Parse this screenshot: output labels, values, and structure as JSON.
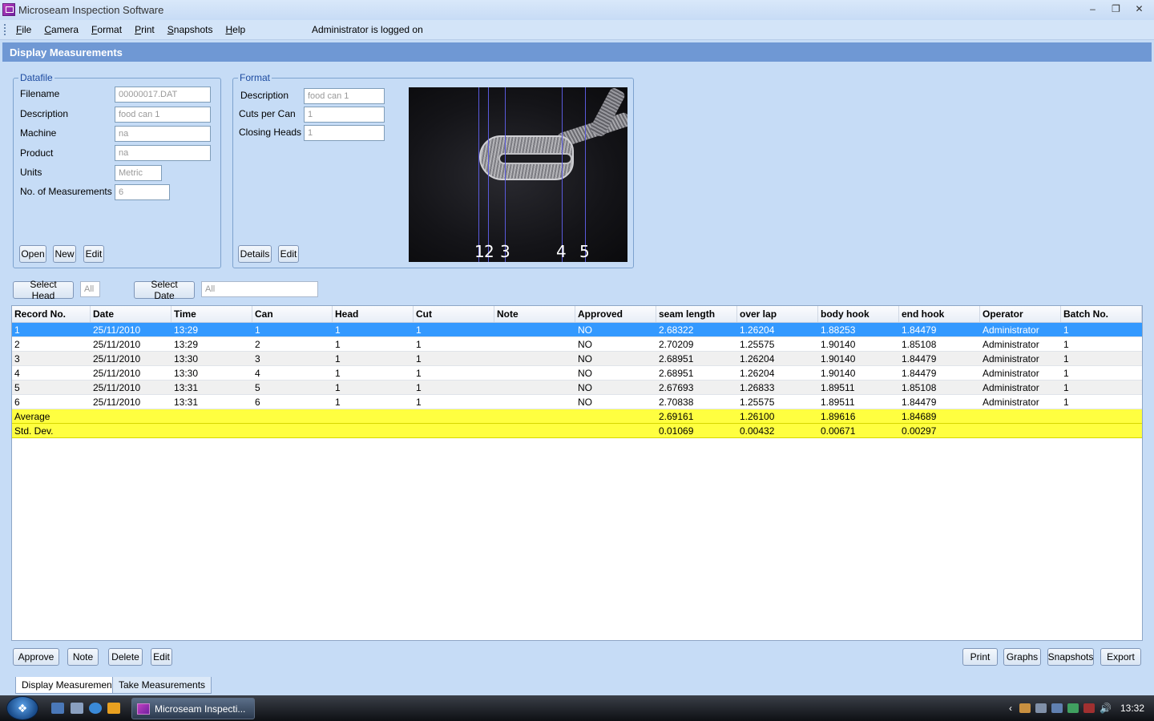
{
  "window": {
    "title": "Microseam Inspection Software"
  },
  "menu": {
    "items": [
      {
        "first": "F",
        "rest": "ile"
      },
      {
        "first": "C",
        "rest": "amera"
      },
      {
        "first": "F",
        "rest": "ormat"
      },
      {
        "first": "P",
        "rest": "rint"
      },
      {
        "first": "S",
        "rest": "napshots"
      },
      {
        "first": "H",
        "rest": "elp"
      }
    ],
    "status": "Administrator is logged on"
  },
  "header": {
    "title": "Display Measurements"
  },
  "datafile": {
    "legend": "Datafile",
    "filename_label": "Filename",
    "filename": "00000017.DAT",
    "description_label": "Description",
    "description": "food can 1",
    "machine_label": "Machine",
    "machine": "na",
    "product_label": "Product",
    "product": "na",
    "units_label": "Units",
    "units": "Metric",
    "count_label": "No. of Measurements",
    "count": "6",
    "open": "Open",
    "new": "New",
    "edit": "Edit"
  },
  "format": {
    "legend": "Format",
    "description_label": "Description",
    "description": "food can 1",
    "cuts_label": "Cuts per Can",
    "cuts": "1",
    "heads_label": "Closing Heads",
    "heads": "1",
    "details": "Details",
    "edit": "Edit",
    "line_labels": [
      "1",
      "2",
      "3",
      "4",
      "5"
    ]
  },
  "filters": {
    "select_head": "Select Head",
    "head_value": "All",
    "select_date": "Select Date",
    "date_value": "All"
  },
  "table": {
    "columns": [
      "Record No.",
      "Date",
      "Time",
      "Can",
      "Head",
      "Cut",
      "Note",
      "Approved",
      "seam length",
      "over lap",
      "body hook",
      "end hook",
      "Operator",
      "Batch No."
    ],
    "rows": [
      [
        "1",
        "25/11/2010",
        "13:29",
        "1",
        "1",
        "1",
        "",
        "NO",
        "2.68322",
        "1.26204",
        "1.88253",
        "1.84479",
        "Administrator",
        "1"
      ],
      [
        "2",
        "25/11/2010",
        "13:29",
        "2",
        "1",
        "1",
        "",
        "NO",
        "2.70209",
        "1.25575",
        "1.90140",
        "1.85108",
        "Administrator",
        "1"
      ],
      [
        "3",
        "25/11/2010",
        "13:30",
        "3",
        "1",
        "1",
        "",
        "NO",
        "2.68951",
        "1.26204",
        "1.90140",
        "1.84479",
        "Administrator",
        "1"
      ],
      [
        "4",
        "25/11/2010",
        "13:30",
        "4",
        "1",
        "1",
        "",
        "NO",
        "2.68951",
        "1.26204",
        "1.90140",
        "1.84479",
        "Administrator",
        "1"
      ],
      [
        "5",
        "25/11/2010",
        "13:31",
        "5",
        "1",
        "1",
        "",
        "NO",
        "2.67693",
        "1.26833",
        "1.89511",
        "1.85108",
        "Administrator",
        "1"
      ],
      [
        "6",
        "25/11/2010",
        "13:31",
        "6",
        "1",
        "1",
        "",
        "NO",
        "2.70838",
        "1.25575",
        "1.89511",
        "1.84479",
        "Administrator",
        "1"
      ]
    ],
    "average": {
      "label": "Average",
      "values": [
        "2.69161",
        "1.26100",
        "1.89616",
        "1.84689"
      ]
    },
    "stddev": {
      "label": "Std. Dev.",
      "values": [
        "0.01069",
        "0.00432",
        "0.00671",
        "0.00297"
      ]
    }
  },
  "bottom_buttons": {
    "approve": "Approve",
    "note": "Note",
    "delete": "Delete",
    "edit": "Edit",
    "print": "Print",
    "graphs": "Graphs",
    "snapshots": "Snapshots",
    "export": "Export"
  },
  "tabs": [
    "Display Measurements",
    "Take Measurements"
  ],
  "taskbar": {
    "task_label": "Microseam Inspecti...",
    "clock": "13:32"
  }
}
